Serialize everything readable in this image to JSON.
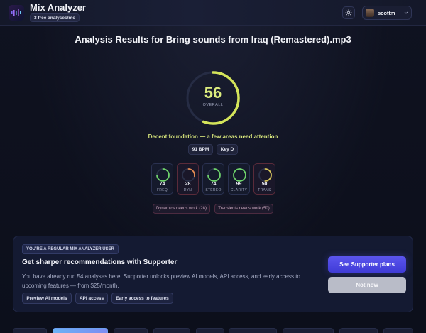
{
  "header": {
    "app_title": "Mix Analyzer",
    "tier_badge": "3 free analyses/mo",
    "username": "scottm"
  },
  "main": {
    "title": "Analysis Results for Bring sounds from Iraq (Remastered).mp3",
    "overall": {
      "value": "56",
      "label": "OVERALL",
      "fraction": 0.56,
      "color": "#d4e45a"
    },
    "summary": "Decent foundation — a few areas need attention",
    "chips": [
      "91 BPM",
      "Key D"
    ],
    "metrics": [
      {
        "value": "74",
        "name": "FREQ",
        "fraction": 0.74,
        "color": "#6ed36a",
        "warn": false
      },
      {
        "value": "28",
        "name": "DYN",
        "fraction": 0.28,
        "color": "#e58b52",
        "warn": true
      },
      {
        "value": "74",
        "name": "STEREO",
        "fraction": 0.74,
        "color": "#6ed36a",
        "warn": false
      },
      {
        "value": "99",
        "name": "CLARITY",
        "fraction": 0.99,
        "color": "#6ed36a",
        "warn": false
      },
      {
        "value": "50",
        "name": "TRANS",
        "fraction": 0.5,
        "color": "#d8c65a",
        "warn": true
      }
    ],
    "issues": [
      "Dynamics needs work (28)",
      "Transients needs work (50)"
    ]
  },
  "upsell": {
    "badge": "YOU'RE A REGULAR MIX ANALYZER USER",
    "title": "Get sharper recommendations with Supporter",
    "text": "You have already run 54 analyses here. Supporter unlocks preview AI models, API access, and early access to upcoming features — from $25/month.",
    "features": [
      "Preview AI models",
      "API access",
      "Early access to features"
    ],
    "primary_label": "See Supporter plans",
    "secondary_label": "Not now"
  },
  "icons": {
    "logo": "waveform-icon",
    "theme": "sun-icon",
    "caret": "chevron-down-icon"
  }
}
